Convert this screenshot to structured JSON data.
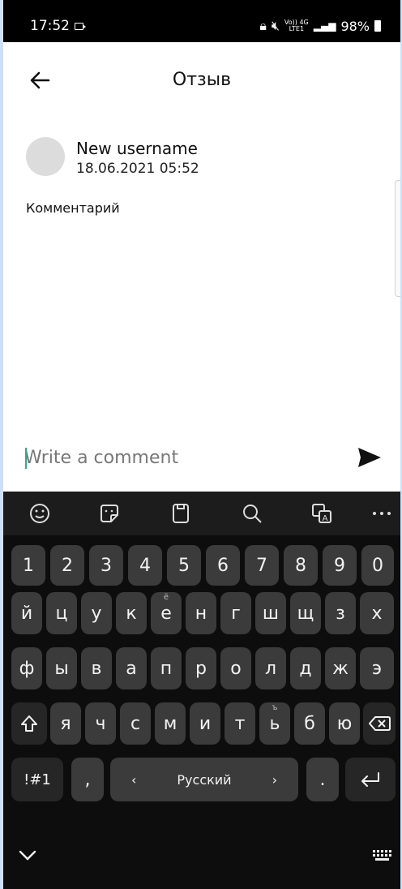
{
  "status": {
    "time": "17:52",
    "battery": "98%",
    "net_top": "Vo)) 4G",
    "net_bottom": "LTE1"
  },
  "header": {
    "title": "Отзыв"
  },
  "review": {
    "username": "New username",
    "date": "18.06.2021 05:52",
    "comment": "Комментарий"
  },
  "compose": {
    "placeholder": "Write a comment"
  },
  "keyboard": {
    "row_numbers": [
      "1",
      "2",
      "3",
      "4",
      "5",
      "6",
      "7",
      "8",
      "9",
      "0"
    ],
    "row1": [
      "й",
      "ц",
      "у",
      "к",
      "е",
      "н",
      "г",
      "ш",
      "щ",
      "з",
      "х"
    ],
    "row1_hint_e": "ё",
    "row2": [
      "ф",
      "ы",
      "в",
      "а",
      "п",
      "р",
      "о",
      "л",
      "д",
      "ж",
      "э"
    ],
    "row3": [
      "я",
      "ч",
      "с",
      "м",
      "и",
      "т",
      "ь",
      "б",
      "ю"
    ],
    "row3_hint_soft": "ъ",
    "sym_label": "!#1",
    "comma": ",",
    "space_label": "Русский",
    "space_left": "‹",
    "space_right": "›",
    "period": "."
  }
}
